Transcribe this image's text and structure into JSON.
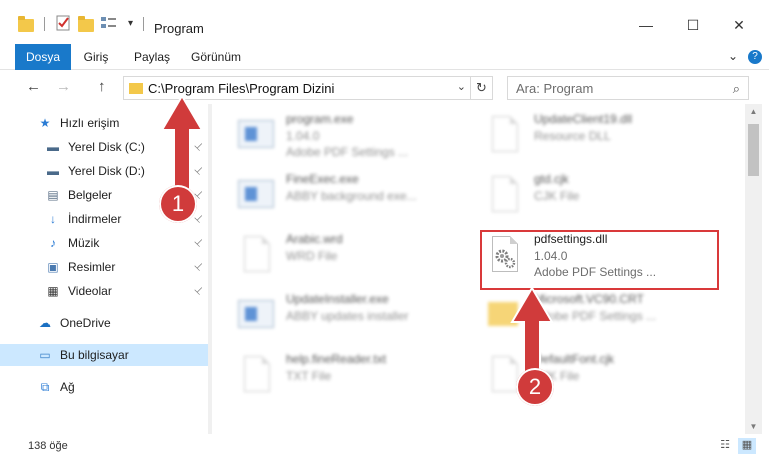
{
  "window": {
    "title": "Program",
    "minimize": "—",
    "maximize": "☐",
    "close": "✕"
  },
  "ribbon": {
    "tabs": [
      "Dosya",
      "Giriş",
      "Paylaş",
      "Görünüm"
    ],
    "expand_icon": "⌄",
    "help_icon": "?"
  },
  "nav": {
    "back": "←",
    "forward": "→",
    "up": "↑",
    "address": "C:\\Program Files\\Program Dizini",
    "dropdown": "⌄",
    "refresh": "↻",
    "search_placeholder": "Ara: Program",
    "search_icon": "⌕"
  },
  "sidebar": {
    "items": [
      {
        "label": "Hızlı erişim",
        "icon": "star-icon",
        "glyph": "★",
        "color": "#2a7bd4"
      },
      {
        "label": "Yerel Disk (C:)",
        "icon": "drive-icon",
        "glyph": "▬",
        "color": "#4a6a8a",
        "pinned": true
      },
      {
        "label": "Yerel Disk (D:)",
        "icon": "drive-icon",
        "glyph": "▬",
        "color": "#4a6a8a",
        "pinned": true
      },
      {
        "label": "Belgeler",
        "icon": "documents-icon",
        "glyph": "▤",
        "color": "#5b6f86",
        "pinned": true
      },
      {
        "label": "İndirmeler",
        "icon": "download-icon",
        "glyph": "↓",
        "color": "#2a7bd4",
        "pinned": true
      },
      {
        "label": "Müzik",
        "icon": "music-icon",
        "glyph": "♪",
        "color": "#2a7bd4",
        "pinned": true
      },
      {
        "label": "Resimler",
        "icon": "pictures-icon",
        "glyph": "▣",
        "color": "#4a7ab0",
        "pinned": true
      },
      {
        "label": "Videolar",
        "icon": "video-icon",
        "glyph": "▦",
        "color": "#3a3a3a",
        "pinned": true
      },
      {
        "label": "OneDrive",
        "icon": "cloud-icon",
        "glyph": "☁",
        "color": "#1a6fc2"
      },
      {
        "label": "Bu bilgisayar",
        "icon": "computer-icon",
        "glyph": "▭",
        "color": "#3b82c8",
        "selected": true
      },
      {
        "label": "Ağ",
        "icon": "network-icon",
        "glyph": "⧉",
        "color": "#2a7bd4"
      }
    ],
    "pin_glyph": "📌"
  },
  "files": [
    {
      "name": "program.exe",
      "version": "1.04.0",
      "desc": "Adobe PDF Settings ...",
      "type": "exe"
    },
    {
      "name": "UpdateClient19.dll",
      "version": "Resource DLL",
      "desc": "",
      "type": "doc"
    },
    {
      "name": "FineExec.exe",
      "version": "ABBY background exe...",
      "desc": "",
      "type": "exe"
    },
    {
      "name": "gtd.cjk",
      "version": "CJK File",
      "desc": "",
      "type": "doc"
    },
    {
      "name": "Arabic.wrd",
      "version": "WRD File",
      "desc": "",
      "type": "doc"
    },
    {
      "name": "pdfsettings.dll",
      "version": "1.04.0",
      "desc": "Adobe PDF Settings ...",
      "type": "dll"
    },
    {
      "name": "UpdateInstaller.exe",
      "version": "ABBY updates installer",
      "desc": "",
      "type": "exe"
    },
    {
      "name": "Microsoft.VC90.CRT",
      "version": "Adobe PDF Settings ...",
      "desc": "",
      "type": "folder"
    },
    {
      "name": "help.fineReader.txt",
      "version": "TXT File",
      "desc": "",
      "type": "doc"
    },
    {
      "name": "DefaultFont.cjk",
      "version": "CJK File",
      "desc": "",
      "type": "doc"
    }
  ],
  "status": {
    "count": "138 öğe",
    "details_view": "☷",
    "tiles_view": "▦"
  },
  "annotations": {
    "step1": "1",
    "step2": "2",
    "color": "#d03b3b"
  }
}
